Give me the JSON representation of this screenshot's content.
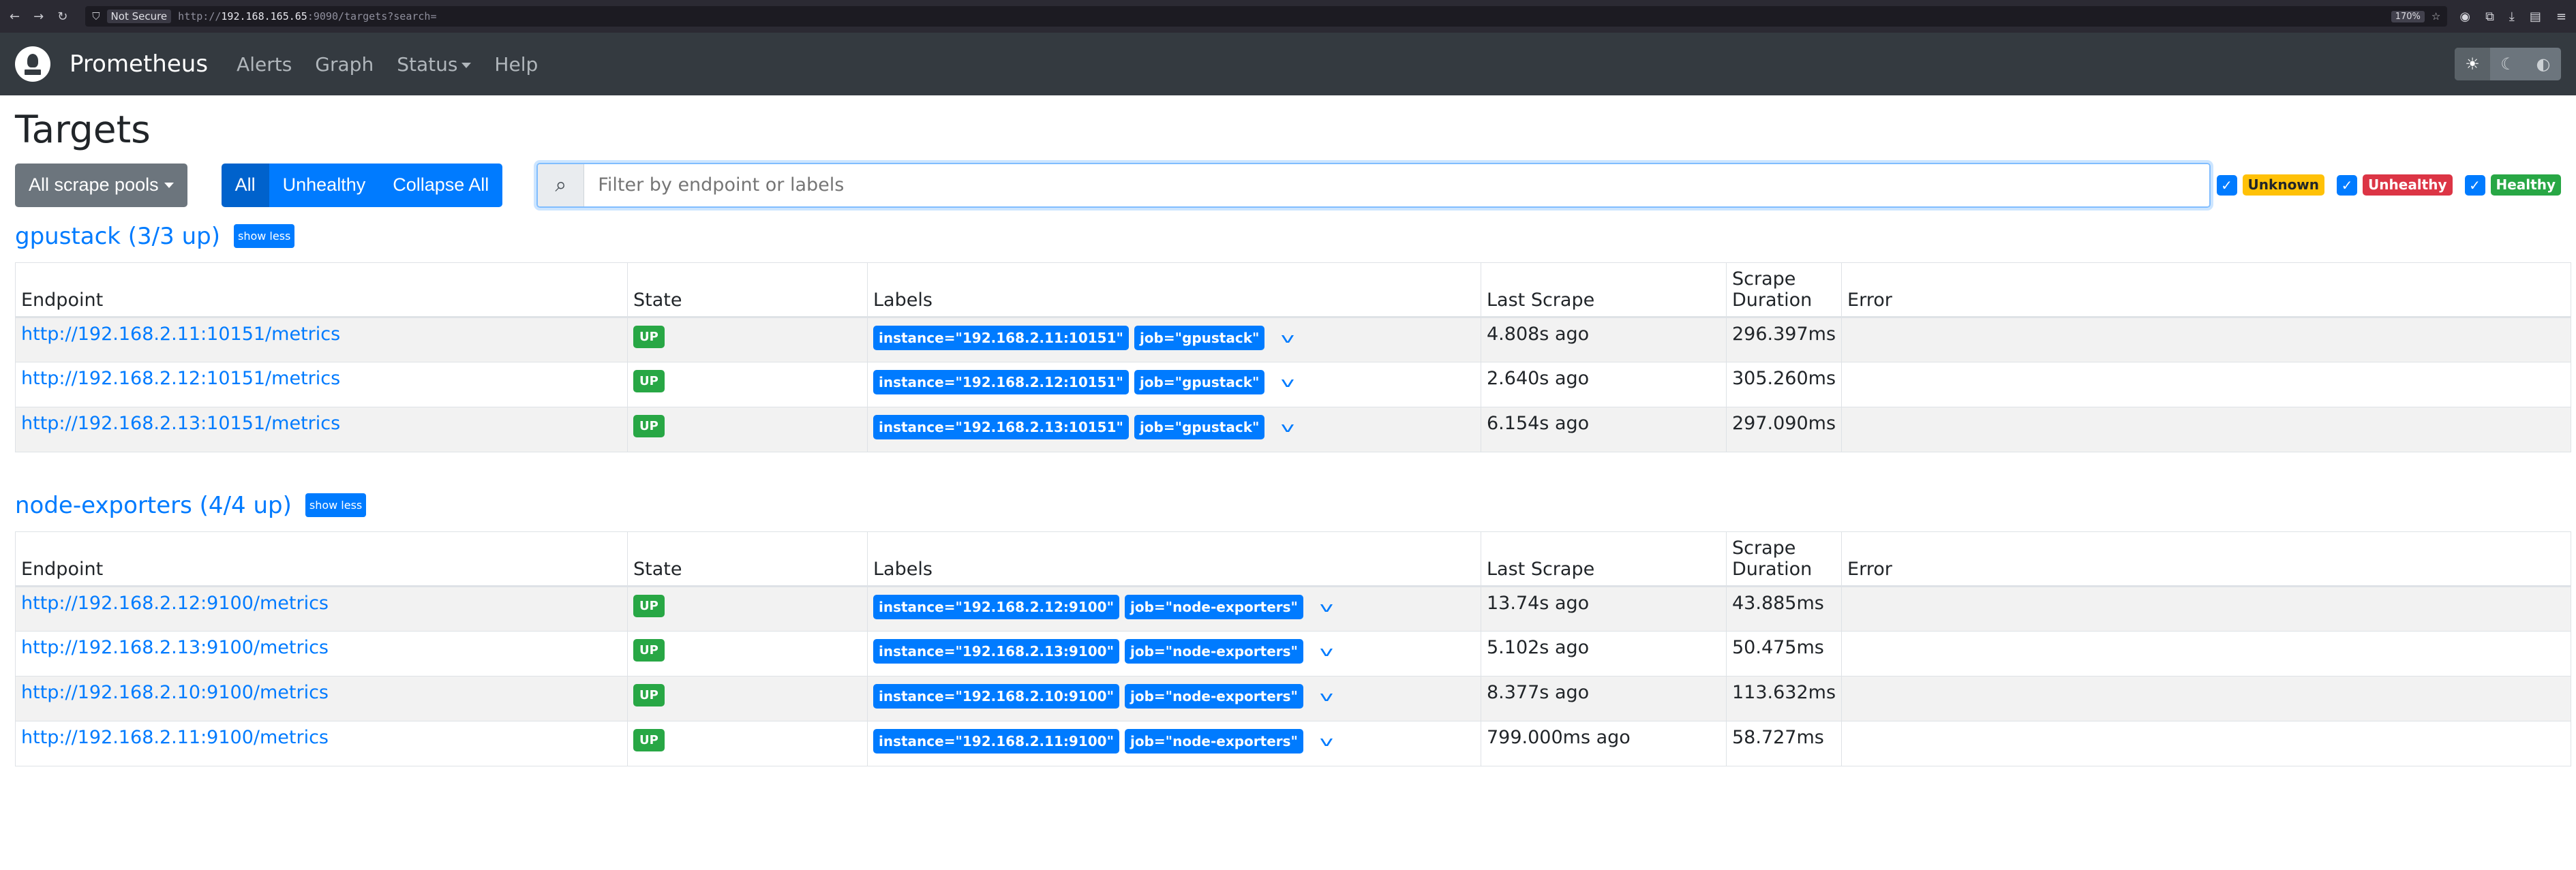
{
  "browser": {
    "not_secure": "Not Secure",
    "url_prefix": "http://",
    "url_host": "192.168.165.65",
    "url_rest": ":9090/targets?search=",
    "zoom": "170%"
  },
  "navbar": {
    "brand": "Prometheus",
    "links": {
      "alerts": "Alerts",
      "graph": "Graph",
      "status": "Status",
      "help": "Help"
    }
  },
  "page": {
    "title": "Targets"
  },
  "controls": {
    "scrape_pools": "All scrape pools",
    "all": "All",
    "unhealthy": "Unhealthy",
    "collapse": "Collapse All",
    "search_placeholder": "Filter by endpoint or labels",
    "filters": {
      "unknown": "Unknown",
      "unhealthy": "Unhealthy",
      "healthy": "Healthy"
    }
  },
  "columns": {
    "endpoint": "Endpoint",
    "state": "State",
    "labels": "Labels",
    "last_scrape": "Last Scrape",
    "duration": "Scrape Duration",
    "error": "Error"
  },
  "pools": [
    {
      "title": "gpustack (3/3 up)",
      "show_less": "show less",
      "targets": [
        {
          "endpoint": "http://192.168.2.11:10151/metrics",
          "state": "UP",
          "instance": "instance=\"192.168.2.11:10151\"",
          "job": "job=\"gpustack\"",
          "last_scrape": "4.808s ago",
          "duration": "296.397ms",
          "error": ""
        },
        {
          "endpoint": "http://192.168.2.12:10151/metrics",
          "state": "UP",
          "instance": "instance=\"192.168.2.12:10151\"",
          "job": "job=\"gpustack\"",
          "last_scrape": "2.640s ago",
          "duration": "305.260ms",
          "error": ""
        },
        {
          "endpoint": "http://192.168.2.13:10151/metrics",
          "state": "UP",
          "instance": "instance=\"192.168.2.13:10151\"",
          "job": "job=\"gpustack\"",
          "last_scrape": "6.154s ago",
          "duration": "297.090ms",
          "error": ""
        }
      ]
    },
    {
      "title": "node-exporters (4/4 up)",
      "show_less": "show less",
      "targets": [
        {
          "endpoint": "http://192.168.2.12:9100/metrics",
          "state": "UP",
          "instance": "instance=\"192.168.2.12:9100\"",
          "job": "job=\"node-exporters\"",
          "last_scrape": "13.74s ago",
          "duration": "43.885ms",
          "error": ""
        },
        {
          "endpoint": "http://192.168.2.13:9100/metrics",
          "state": "UP",
          "instance": "instance=\"192.168.2.13:9100\"",
          "job": "job=\"node-exporters\"",
          "last_scrape": "5.102s ago",
          "duration": "50.475ms",
          "error": ""
        },
        {
          "endpoint": "http://192.168.2.10:9100/metrics",
          "state": "UP",
          "instance": "instance=\"192.168.2.10:9100\"",
          "job": "job=\"node-exporters\"",
          "last_scrape": "8.377s ago",
          "duration": "113.632ms",
          "error": ""
        },
        {
          "endpoint": "http://192.168.2.11:9100/metrics",
          "state": "UP",
          "instance": "instance=\"192.168.2.11:9100\"",
          "job": "job=\"node-exporters\"",
          "last_scrape": "799.000ms ago",
          "duration": "58.727ms",
          "error": ""
        }
      ]
    }
  ],
  "icons": {
    "logo": "prometheus-logo",
    "search": "search-icon",
    "expand": "chevron-down-icon",
    "checkbox": "checkmark-icon"
  },
  "colors": {
    "primary": "#007bff",
    "success": "#28a745",
    "danger": "#dc3545",
    "warning": "#ffc107",
    "navbar": "#343a40"
  }
}
